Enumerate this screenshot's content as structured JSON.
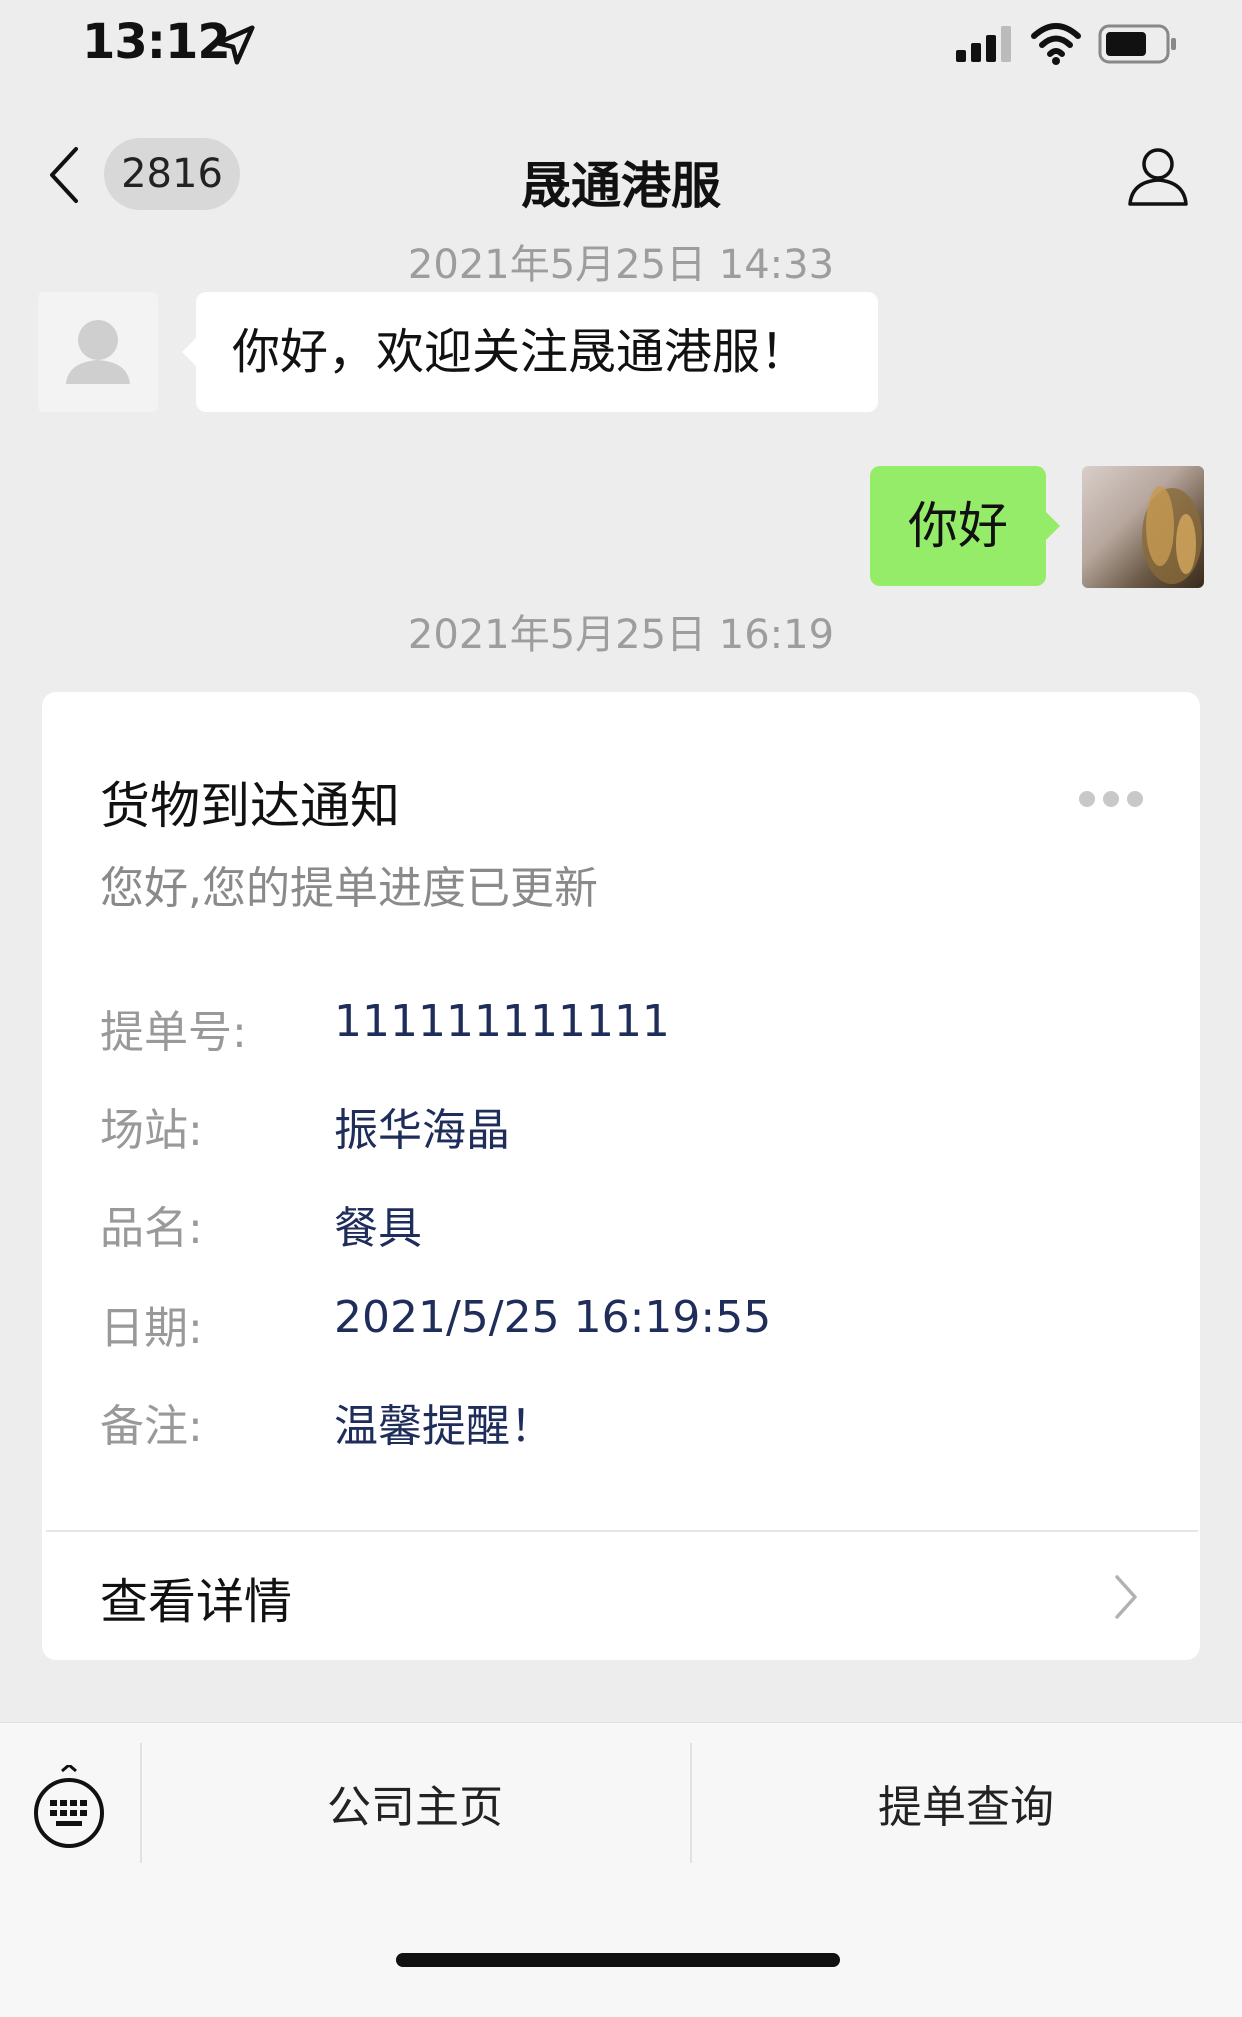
{
  "status_bar": {
    "time": "13:12"
  },
  "nav": {
    "back_count": "2816",
    "title": "晟通港服"
  },
  "messages": {
    "timestamp_1": "2021年5月25日 14:33",
    "incoming_text": "你好，欢迎关注晟通港服！",
    "outgoing_text": "你好",
    "timestamp_2": "2021年5月25日 16:19"
  },
  "card": {
    "title": "货物到达通知",
    "subtitle": "您好,您的提单进度已更新",
    "rows": [
      {
        "label": "提单号:",
        "value": "111111111111"
      },
      {
        "label": "场站:",
        "value": "振华海晶"
      },
      {
        "label": "品名:",
        "value": "餐具"
      },
      {
        "label": "日期:",
        "value": "2021/5/25 16:19:55"
      },
      {
        "label": "备注:",
        "value": "温馨提醒！"
      }
    ],
    "detail_label": "查看详情"
  },
  "menu": {
    "items": [
      "公司主页",
      "提单查询"
    ]
  },
  "colors": {
    "outgoing_bubble": "#95ec69",
    "value_text": "#1f2d5b",
    "background": "#ededed"
  }
}
